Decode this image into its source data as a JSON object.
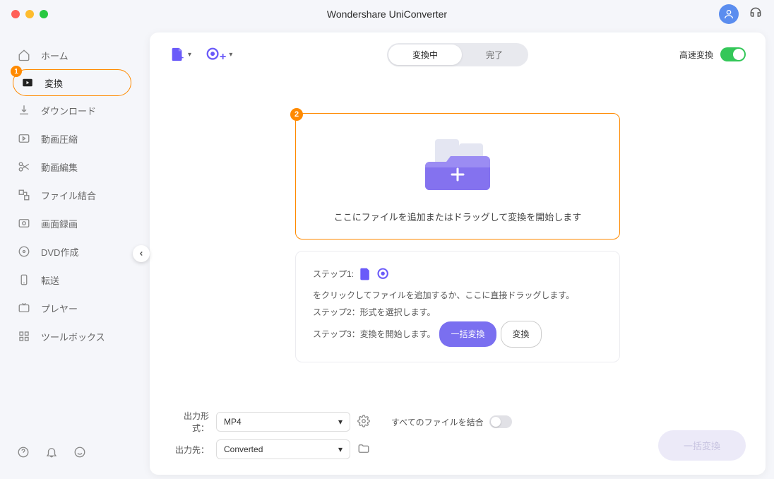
{
  "title": "Wondershare UniConverter",
  "sidebar": {
    "items": [
      {
        "label": "ホーム"
      },
      {
        "label": "変換"
      },
      {
        "label": "ダウンロード"
      },
      {
        "label": "動画圧縮"
      },
      {
        "label": "動画編集"
      },
      {
        "label": "ファイル結合"
      },
      {
        "label": "画面録画"
      },
      {
        "label": "DVD作成"
      },
      {
        "label": "転送"
      },
      {
        "label": "プレヤー"
      },
      {
        "label": "ツールボックス"
      }
    ],
    "active_badge": "1"
  },
  "tabs": {
    "converting": "変換中",
    "completed": "完了"
  },
  "toolbar": {
    "high_speed_label": "高速変換"
  },
  "dropzone": {
    "badge": "2",
    "text": "ここにファイルを追加またはドラッグして変換を開始します"
  },
  "steps": {
    "s1_prefix": "ステップ1:",
    "s1_suffix": "をクリックしてファイルを追加するか、ここに直接ドラッグします。",
    "s2": "ステップ2：形式を選択します。",
    "s3_prefix": "ステップ3：変換を開始します。",
    "batch_label": "一括変換",
    "convert_label": "変換"
  },
  "footer": {
    "format_label": "出力形式：",
    "format_value": "MP4",
    "dest_label": "出力先：",
    "dest_value": "Converted",
    "merge_label": "すべてのファイルを結合",
    "action_label": "一括変換"
  }
}
